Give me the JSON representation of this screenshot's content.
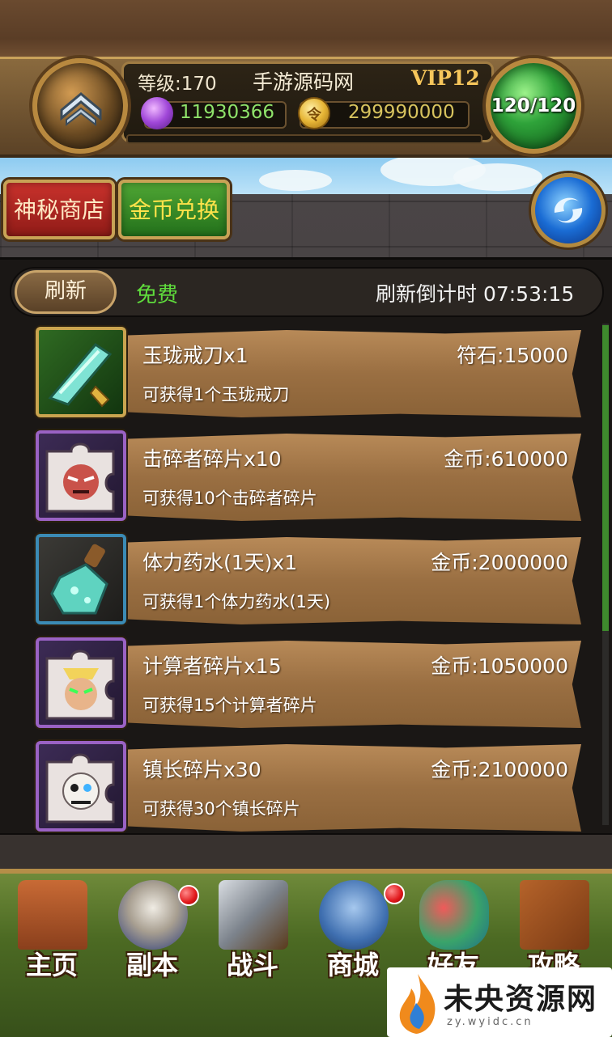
{
  "header": {
    "level": "等级:170",
    "server_name": "手游源码网",
    "vip": "VIP12",
    "gem_amount": "11930366",
    "gold_amount": "299990000",
    "gold_icon_glyph": "令",
    "stamina": "120/120"
  },
  "shop_tabs": {
    "mystery_shop": "神秘商店",
    "gold_exchange": "金币兑换"
  },
  "refresh_bar": {
    "button": "刷新",
    "cost": "免费",
    "countdown": "刷新倒计时 07:53:15"
  },
  "items": [
    {
      "name": "玉珑戒刀x1",
      "price": "符石:15000",
      "desc": "可获得1个玉珑戒刀",
      "icon": "jade-blade-icon"
    },
    {
      "name": "击碎者碎片x10",
      "price": "金币:610000",
      "desc": "可获得10个击碎者碎片",
      "icon": "smasher-fragment-icon"
    },
    {
      "name": "体力药水(1天)x1",
      "price": "金币:2000000",
      "desc": "可获得1个体力药水(1天)",
      "icon": "stamina-potion-icon"
    },
    {
      "name": "计算者碎片x15",
      "price": "金币:1050000",
      "desc": "可获得15个计算者碎片",
      "icon": "calculator-fragment-icon"
    },
    {
      "name": "镇长碎片x30",
      "price": "金币:2100000",
      "desc": "可获得30个镇长碎片",
      "icon": "mayor-fragment-icon"
    }
  ],
  "nav": {
    "home": "主页",
    "dungeon": "副本",
    "battle": "战斗",
    "shop": "商城",
    "friends": "好友",
    "guide": "攻略"
  },
  "watermark": {
    "text": "未央资源网",
    "url": "zy.wyidc.cn"
  },
  "colors": {
    "free_green": "#5fdc3c",
    "gem_green": "#8ee26a",
    "vip_gold": "#f6c65b"
  }
}
